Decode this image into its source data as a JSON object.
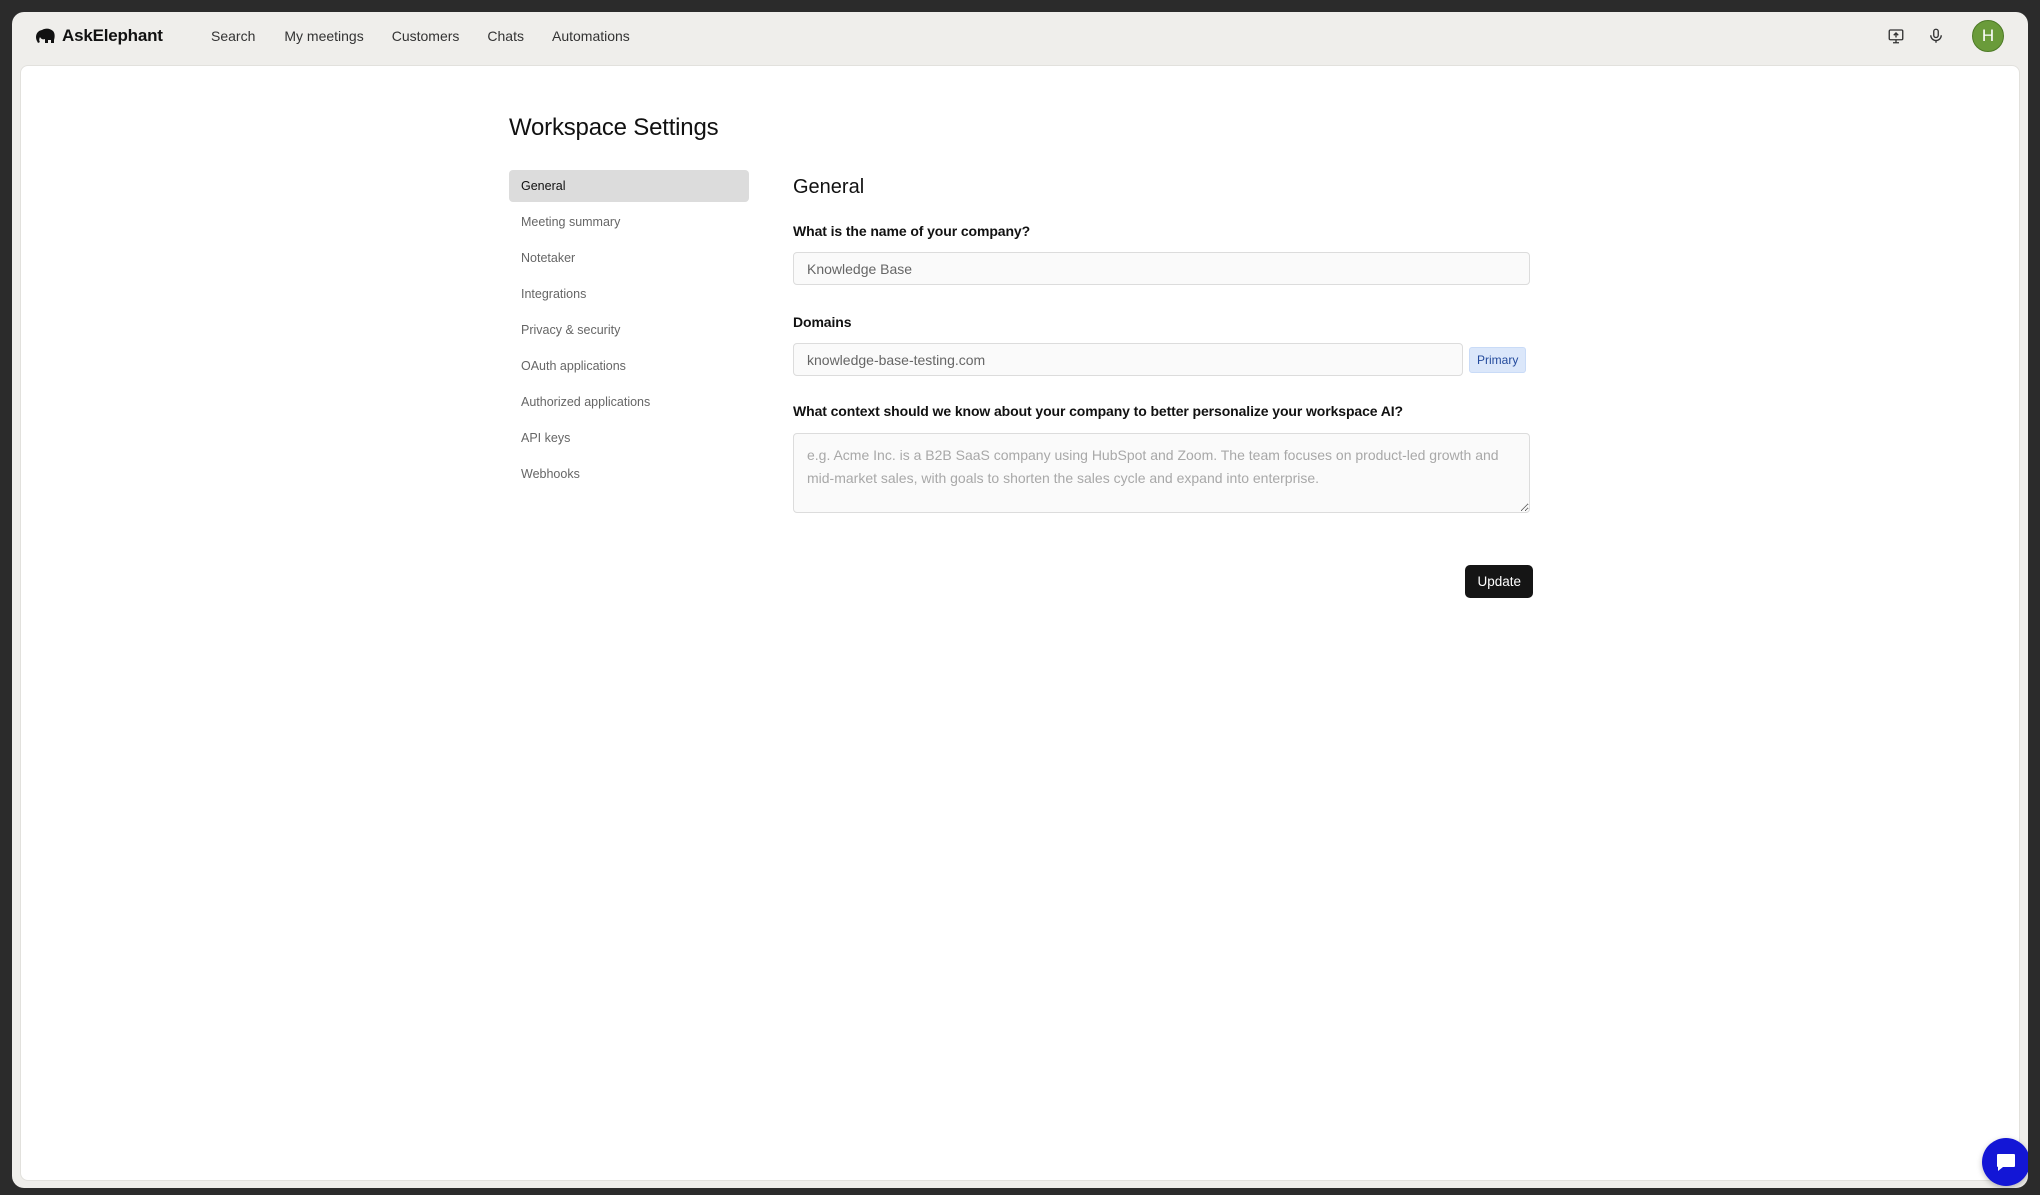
{
  "app": {
    "name": "AskElephant"
  },
  "nav": {
    "items": [
      {
        "label": "Search"
      },
      {
        "label": "My meetings"
      },
      {
        "label": "Customers"
      },
      {
        "label": "Chats"
      },
      {
        "label": "Automations"
      }
    ]
  },
  "header_icons": [
    "screen-share-icon",
    "microphone-icon"
  ],
  "user": {
    "initial": "H",
    "avatar_color": "#6a9b3a"
  },
  "page": {
    "title": "Workspace Settings"
  },
  "sidebar": {
    "items": [
      {
        "label": "General",
        "active": true
      },
      {
        "label": "Meeting summary"
      },
      {
        "label": "Notetaker"
      },
      {
        "label": "Integrations"
      },
      {
        "label": "Privacy & security"
      },
      {
        "label": "OAuth applications"
      },
      {
        "label": "Authorized applications"
      },
      {
        "label": "API keys"
      },
      {
        "label": "Webhooks"
      }
    ]
  },
  "general": {
    "title": "General",
    "company_label": "What is the name of your company?",
    "company_value": "Knowledge Base",
    "domains_label": "Domains",
    "domain_value": "knowledge-base-testing.com",
    "domain_badge": "Primary",
    "context_label": "What context should we know about your company to better personalize your workspace AI?",
    "context_placeholder": "e.g. Acme Inc. is a B2B SaaS company using HubSpot and Zoom. The team focuses on product-led growth and mid-market sales, with goals to shorten the sales cycle and expand into enterprise.",
    "context_value": "",
    "update_label": "Update"
  },
  "colors": {
    "accent_fab": "#1316d6",
    "button_dark": "#151515",
    "badge_bg": "#dbe7fa"
  }
}
